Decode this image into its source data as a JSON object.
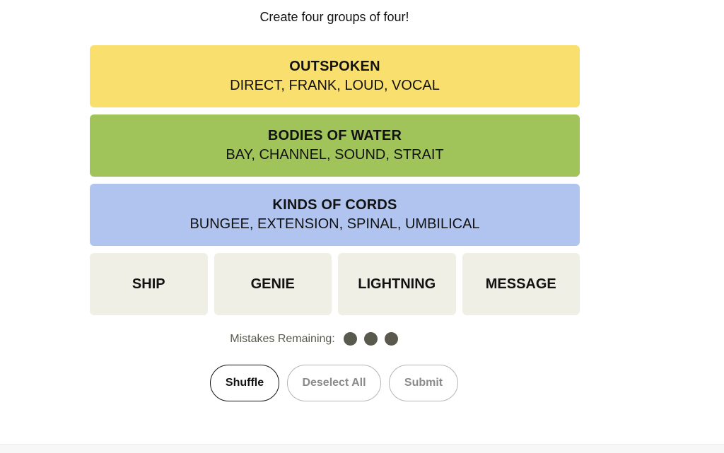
{
  "instructions": "Create four groups of four!",
  "colors": {
    "yellow": "#f9df6d",
    "green": "#a0c35a",
    "blue": "#b0c4ef",
    "tile": "#efefe6",
    "dot": "#5a594e"
  },
  "solved": [
    {
      "category": "OUTSPOKEN",
      "members": "DIRECT, FRANK, LOUD, VOCAL",
      "color": "#f9df6d"
    },
    {
      "category": "BODIES OF WATER",
      "members": "BAY, CHANNEL, SOUND, STRAIT",
      "color": "#a0c35a"
    },
    {
      "category": "KINDS OF CORDS",
      "members": "BUNGEE, EXTENSION, SPINAL, UMBILICAL",
      "color": "#b0c4ef"
    }
  ],
  "tiles": [
    "SHIP",
    "GENIE",
    "LIGHTNING",
    "MESSAGE"
  ],
  "mistakes": {
    "label": "Mistakes Remaining:",
    "remaining": 3
  },
  "controls": {
    "shuffle": "Shuffle",
    "deselect": "Deselect All",
    "submit": "Submit"
  }
}
